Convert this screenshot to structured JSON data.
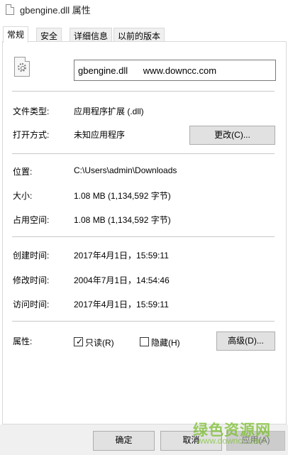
{
  "window": {
    "title": "gbengine.dll 属性"
  },
  "tabs": [
    {
      "label": "常规"
    },
    {
      "label": "安全"
    },
    {
      "label": "详细信息"
    },
    {
      "label": "以前的版本"
    }
  ],
  "file": {
    "name_value": "gbengine.dll      www.downcc.com"
  },
  "rows": {
    "type_label": "文件类型:",
    "type_value": "应用程序扩展 (.dll)",
    "open_label": "打开方式:",
    "open_value": "未知应用程序",
    "change_button": "更改(C)...",
    "location_label": "位置:",
    "location_value": "C:\\Users\\admin\\Downloads",
    "size_label": "大小:",
    "size_value": "1.08 MB (1,134,592 字节)",
    "disk_label": "占用空间:",
    "disk_value": "1.08 MB (1,134,592 字节)",
    "created_label": "创建时间:",
    "created_value": "2017年4月1日，15:59:11",
    "modified_label": "修改时间:",
    "modified_value": "2004年7月1日，14:54:46",
    "accessed_label": "访问时间:",
    "accessed_value": "2017年4月1日，15:59:11",
    "attr_label": "属性:",
    "readonly_label": "只读(R)",
    "readonly_checked": true,
    "hidden_label": "隐藏(H)",
    "hidden_checked": false,
    "advanced_button": "高级(D)..."
  },
  "footer": {
    "ok": "确定",
    "cancel": "取消",
    "apply": "应用(A)"
  },
  "watermark": {
    "text": "绿色资源网",
    "sub": "www.downcc.com"
  }
}
